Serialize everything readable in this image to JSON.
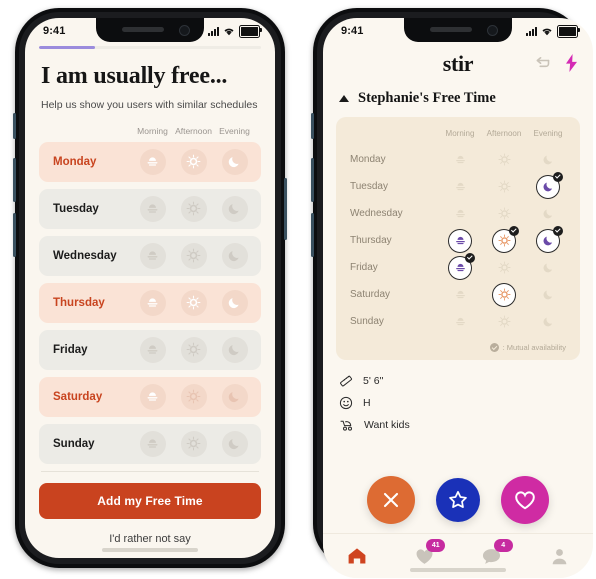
{
  "left_phone": {
    "status_bar": {
      "time": "9:41",
      "signal_icon": "cellular-bars-icon",
      "wifi_icon": "wifi-icon",
      "battery_icon": "battery-icon"
    },
    "progress": {
      "percent": 25,
      "color": "#9b8cdd"
    },
    "title": "I am usually free...",
    "subtitle": "Help us show you users with similar schedules",
    "columns": [
      "Morning",
      "Afternoon",
      "Evening"
    ],
    "accent_color": "#c9431f",
    "rows": [
      {
        "day": "Monday",
        "active": true,
        "slots": [
          true,
          true,
          true
        ]
      },
      {
        "day": "Tuesday",
        "active": false,
        "slots": [
          false,
          false,
          false
        ]
      },
      {
        "day": "Wednesday",
        "active": false,
        "slots": [
          false,
          false,
          false
        ]
      },
      {
        "day": "Thursday",
        "active": true,
        "slots": [
          true,
          true,
          true
        ]
      },
      {
        "day": "Friday",
        "active": false,
        "slots": [
          false,
          false,
          false
        ]
      },
      {
        "day": "Saturday",
        "active": true,
        "slots": [
          true,
          false,
          false
        ]
      },
      {
        "day": "Sunday",
        "active": false,
        "slots": [
          false,
          false,
          false
        ]
      }
    ],
    "primary_button": "Add my Free Time",
    "secondary_link": "I'd rather not say"
  },
  "right_phone": {
    "status_bar": {
      "time": "9:41",
      "signal_icon": "cellular-bars-icon",
      "wifi_icon": "wifi-icon",
      "battery_icon": "battery-icon"
    },
    "brand": "stir",
    "header_actions": [
      {
        "name": "rewind-icon",
        "color": "#c9c3b8"
      },
      {
        "name": "boost-bolt-icon",
        "color": "#d42bb4"
      }
    ],
    "section_title": "Stephanie's Free Time",
    "columns": [
      "Morning",
      "Afternoon",
      "Evening"
    ],
    "grid_rows": [
      {
        "day": "Monday",
        "cells": [
          {
            "state": "off",
            "mutual": false
          },
          {
            "state": "off",
            "mutual": false
          },
          {
            "state": "off",
            "mutual": false
          }
        ]
      },
      {
        "day": "Tuesday",
        "cells": [
          {
            "state": "off",
            "mutual": false
          },
          {
            "state": "off",
            "mutual": false
          },
          {
            "state": "on",
            "mutual": true
          }
        ]
      },
      {
        "day": "Wednesday",
        "cells": [
          {
            "state": "off",
            "mutual": false
          },
          {
            "state": "off",
            "mutual": false
          },
          {
            "state": "off",
            "mutual": false
          }
        ]
      },
      {
        "day": "Thursday",
        "cells": [
          {
            "state": "on",
            "mutual": false
          },
          {
            "state": "on",
            "mutual": true
          },
          {
            "state": "on",
            "mutual": true
          }
        ]
      },
      {
        "day": "Friday",
        "cells": [
          {
            "state": "on",
            "mutual": true
          },
          {
            "state": "off",
            "mutual": false
          },
          {
            "state": "off",
            "mutual": false
          }
        ]
      },
      {
        "day": "Saturday",
        "cells": [
          {
            "state": "off",
            "mutual": false
          },
          {
            "state": "on",
            "mutual": false
          },
          {
            "state": "off",
            "mutual": false
          }
        ]
      },
      {
        "day": "Sunday",
        "cells": [
          {
            "state": "off",
            "mutual": false
          },
          {
            "state": "off",
            "mutual": false
          },
          {
            "state": "off",
            "mutual": false
          }
        ]
      }
    ],
    "legend": ": Mutual availability",
    "facts": [
      {
        "icon": "ruler-icon",
        "text": "5' 6\""
      },
      {
        "icon": "smiley-icon",
        "text": "H"
      },
      {
        "icon": "stroller-icon",
        "text": "Want kids"
      }
    ],
    "actions": [
      {
        "name": "nope-button",
        "icon": "close-icon",
        "color": "#dd6b33"
      },
      {
        "name": "superlike-button",
        "icon": "star-icon",
        "color": "#1a31b8"
      },
      {
        "name": "like-button",
        "icon": "heart-icon",
        "color": "#cf2ba3"
      }
    ],
    "tabs": [
      {
        "name": "tab-home",
        "icon": "home-icon",
        "active": true,
        "badge": ""
      },
      {
        "name": "tab-likes",
        "icon": "heart-icon",
        "active": false,
        "badge": "41"
      },
      {
        "name": "tab-messages",
        "icon": "chat-icon",
        "active": false,
        "badge": "4"
      },
      {
        "name": "tab-profile",
        "icon": "person-icon",
        "active": false,
        "badge": ""
      }
    ]
  }
}
